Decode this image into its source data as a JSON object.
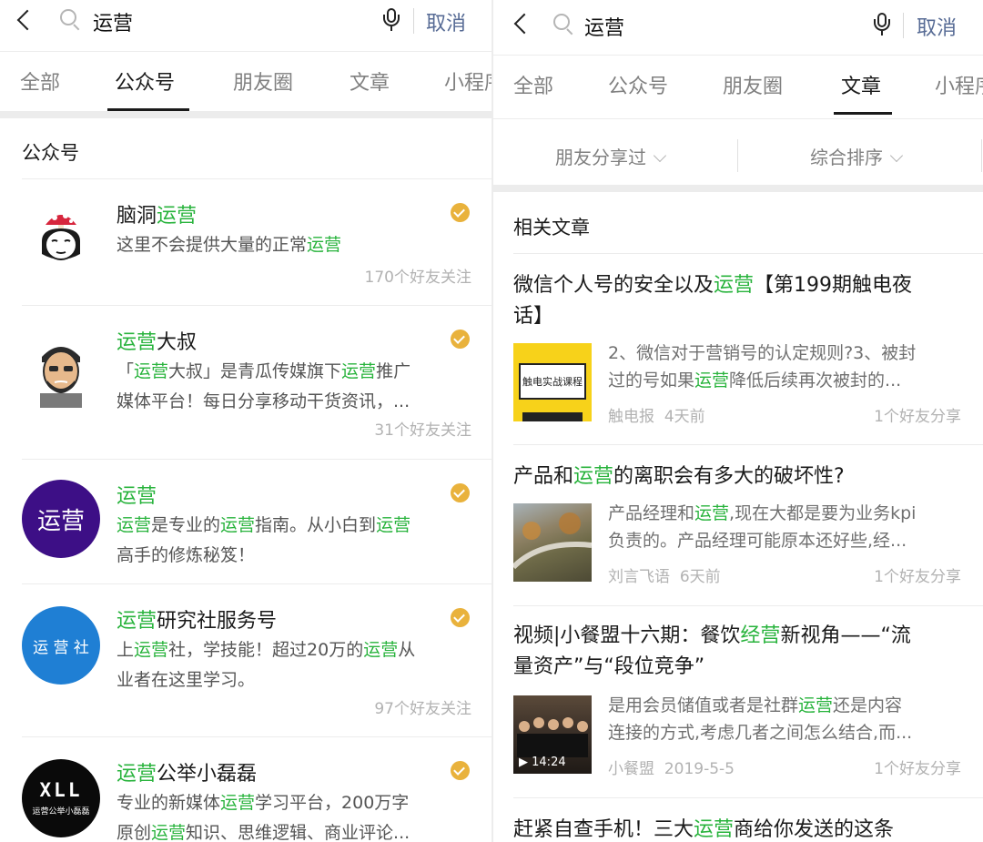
{
  "search": {
    "query": "运营",
    "cancel_label": "取消"
  },
  "colors": {
    "highlight": "#28b33c",
    "link": "#576b95",
    "verified": "#e9b23c"
  },
  "left": {
    "tabs": [
      "全部",
      "公众号",
      "朋友圈",
      "文章",
      "小程序"
    ],
    "active_tab": "公众号",
    "section_title": "公众号",
    "accounts": [
      {
        "name_pre": "脑洞",
        "name_hl": "运营",
        "name_post": "",
        "desc1_pre": "这里不会提供大量的正常",
        "desc1_hl": "运营",
        "desc2": "",
        "follow": "170个好友关注"
      },
      {
        "name_pre": "",
        "name_hl": "运营",
        "name_post": "大叔",
        "desc1_a": "「",
        "desc1_b": "运营",
        "desc1_c": "大叔」是青瓜传媒旗下",
        "desc1_d": "运营",
        "desc1_e": "推广",
        "desc2": "媒体平台！每日分享移动干货资讯，...",
        "follow": "31个好友关注"
      },
      {
        "name_pre": "",
        "name_hl": "运营",
        "name_post": "",
        "avatar_text": "运营",
        "desc1_a": "运营",
        "desc1_b": "是专业的",
        "desc1_c": "运营",
        "desc1_d": "指南。从小白到",
        "desc1_e": "运营",
        "desc2": "高手的修炼秘笈！",
        "follow": ""
      },
      {
        "name_pre": "",
        "name_hl": "运营",
        "name_post": "研究社服务号",
        "avatar_text": "运 营 社",
        "desc1_a": "上",
        "desc1_b": "运营",
        "desc1_c": "社，学技能！超过20万的",
        "desc1_d": "运营",
        "desc1_e": "从",
        "desc2": "业者在这里学习。",
        "follow": "97个好友关注"
      },
      {
        "name_pre": "",
        "name_hl": "运营",
        "name_post": "公举小磊磊",
        "avatar_text": "XLL",
        "avatar_sub": "运营公举小磊磊",
        "desc1_a": "专业的新媒体",
        "desc1_b": "运营",
        "desc1_c": "学习平台，200万字",
        "desc2_a": "原创",
        "desc2_b": "运营",
        "desc2_c": "知识、思维逻辑、商业评论...",
        "follow": ""
      }
    ]
  },
  "right": {
    "tabs": [
      "全部",
      "公众号",
      "朋友圈",
      "文章",
      "小程序"
    ],
    "active_tab": "文章",
    "filters": [
      "朋友分享过",
      "综合排序"
    ],
    "section_title": "相关文章",
    "articles": [
      {
        "title1_a": "微信个人号的安全以及",
        "title1_b": "运营",
        "title1_c": "【第199期触电夜",
        "title2": "话】",
        "thumb_text": "触电实战课程",
        "snip1": "2、微信对于营销号的认定规则?3、被封",
        "snip2_a": "过的号如果",
        "snip2_b": "运营",
        "snip2_c": "降低后续再次被封的...",
        "source": "触电报",
        "time": "4天前",
        "share": "1个好友分享"
      },
      {
        "title1_a": "产品和",
        "title1_b": "运营",
        "title1_c": "的离职会有多大的破坏性?",
        "snip1_a": "产品经理和",
        "snip1_b": "运营",
        "snip1_c": ",现在大都是要为业务kpi",
        "snip2": "负责的。产品经理可能原本还好些,经...",
        "source": "刘言飞语",
        "time": "6天前",
        "share": "1个好友分享"
      },
      {
        "title1_a": "视频|小餐盟十六期：餐饮",
        "title1_b": "经营",
        "title1_c": "新视角——“流",
        "title2": "量资产”与“段位竞争”",
        "video_duration": "14:24",
        "snip1_a": "是用会员储值或者是社群",
        "snip1_b": "运营",
        "snip1_c": "还是内容",
        "snip2": "连接的方式,考虑几者之间怎么结合,而...",
        "source": "小餐盟",
        "time": "2019-5-5",
        "share": "1个好友分享"
      },
      {
        "title1_a": "赶紧自查手机！三大",
        "title1_b": "运营",
        "title1_c": "商给你发送的这条"
      }
    ]
  }
}
